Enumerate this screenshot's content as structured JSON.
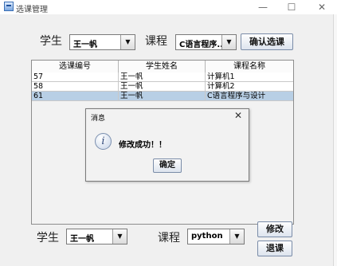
{
  "window": {
    "title": "选课管理",
    "minimize_glyph": "—",
    "maximize_glyph": "☐",
    "close_glyph": "✕"
  },
  "top_form": {
    "student_label": "学生",
    "student_value": "王一帆",
    "course_label": "课程",
    "course_value": "C语言程序...",
    "confirm_button": "确认选课"
  },
  "table": {
    "columns": [
      "选课编号",
      "学生姓名",
      "课程名称"
    ],
    "rows": [
      [
        "57",
        "王一帆",
        "计算机1"
      ],
      [
        "58",
        "王一帆",
        "计算机2"
      ],
      [
        "61",
        "王一帆",
        "C语言程序与设计"
      ]
    ],
    "selected_row": 2
  },
  "dialog": {
    "title": "消息",
    "close_glyph": "✕",
    "icon": "info-icon",
    "message": "修改成功！！",
    "ok_button": "确定"
  },
  "bottom_form": {
    "student_label": "学生",
    "student_value": "王一帆",
    "course_label": "课程",
    "course_value": "python",
    "modify_button": "修改",
    "drop_button": "退课"
  },
  "colors": {
    "selected_row": "#b8cfe5",
    "window_bg": "#f0f0f0"
  }
}
